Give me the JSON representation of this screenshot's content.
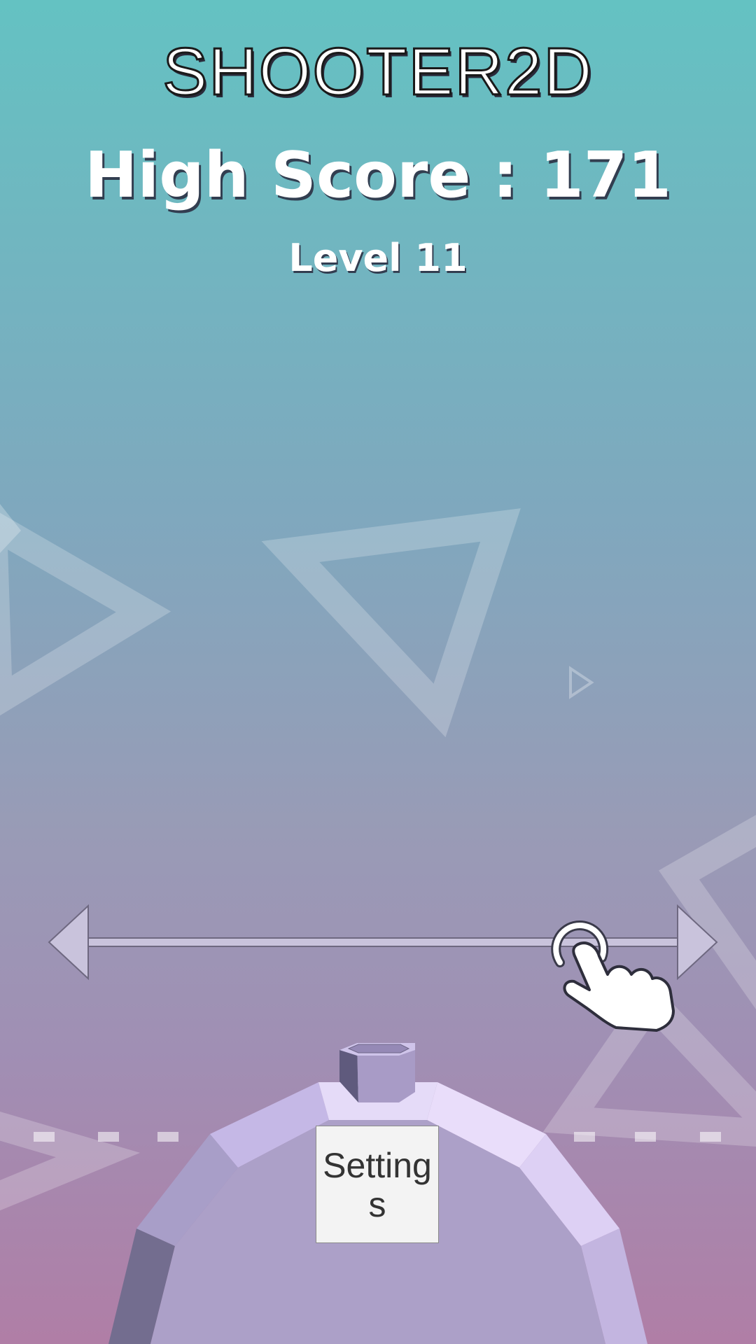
{
  "game": {
    "title": "SHOOTER2D",
    "high_score_text": "High Score : 171",
    "high_score": 171,
    "level_text": "Level 11",
    "level": 11
  },
  "controls": {
    "settings_label": "Settings",
    "swipe_hint": "drag-left-right",
    "swipe_hint_icon": "hand-pointer-icon"
  },
  "colors": {
    "bg_top": "#64c2c2",
    "bg_bottom": "#b07ea6",
    "cannon_body": "#aea0c8",
    "cannon_light": "#e8dcfa",
    "cannon_dark": "#6e6889",
    "text": "#ffffff"
  }
}
